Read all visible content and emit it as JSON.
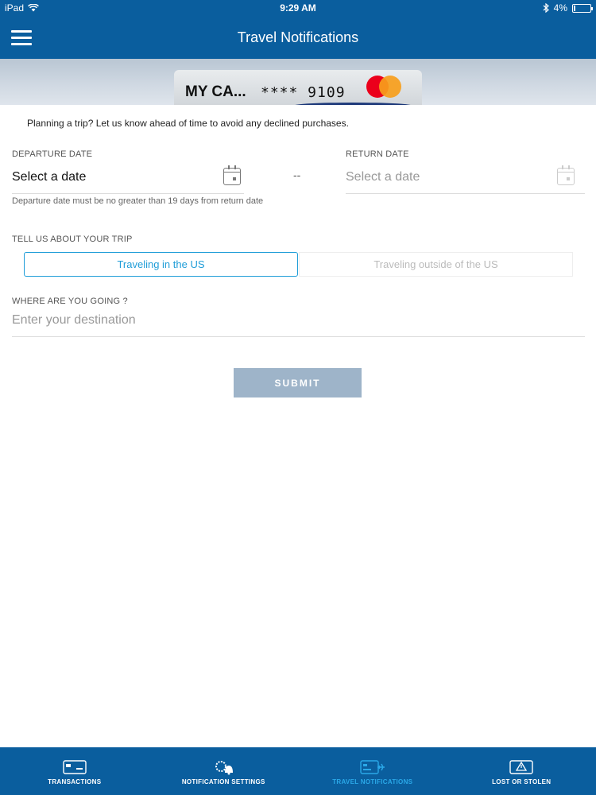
{
  "status": {
    "device": "iPad",
    "time": "9:29 AM",
    "battery": "4%"
  },
  "header": {
    "title": "Travel Notifications"
  },
  "card": {
    "name": "MY CA...",
    "number": "**** 9109"
  },
  "form": {
    "intro": "Planning a trip? Let us know ahead of time to avoid any declined purchases.",
    "departure": {
      "label": "DEPARTURE DATE",
      "value": "Select a date"
    },
    "separator": "--",
    "return": {
      "label": "RETURN DATE",
      "value": "Select a date"
    },
    "hint": "Departure date must be no greater than 19 days from return date",
    "trip_label": "TELL US ABOUT YOUR TRIP",
    "trip_options": [
      "Traveling in the US",
      "Traveling outside of the US"
    ],
    "trip_selected": "Traveling in the US",
    "destination": {
      "label": "WHERE ARE YOU GOING ?",
      "placeholder": "Enter your destination"
    },
    "submit": "SUBMIT"
  },
  "tabs": [
    {
      "label": "TRANSACTIONS",
      "icon": "card-icon",
      "active": false
    },
    {
      "label": "NOTIFICATION SETTINGS",
      "icon": "gear-bell-icon",
      "active": false
    },
    {
      "label": "TRAVEL NOTIFICATIONS",
      "icon": "card-plane-icon",
      "active": true
    },
    {
      "label": "LOST OR STOLEN",
      "icon": "card-alert-icon",
      "active": false
    }
  ],
  "colors": {
    "header": "#0a5e9e",
    "accent": "#1f9dd8",
    "submit_disabled": "#9eb4c9",
    "active_tab": "#2aa8e8"
  }
}
